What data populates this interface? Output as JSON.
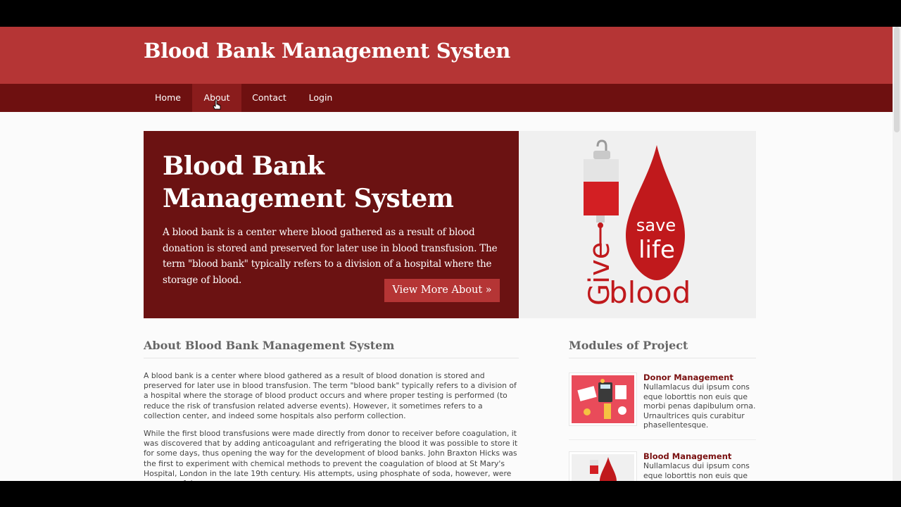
{
  "header": {
    "title": "Blood Bank Management Systen"
  },
  "nav": {
    "items": [
      {
        "label": "Home"
      },
      {
        "label": "About"
      },
      {
        "label": "Contact"
      },
      {
        "label": "Login"
      }
    ],
    "active": "About"
  },
  "hero": {
    "title": "Blood Bank Management System",
    "text": "A blood bank is a center where blood gathered as a result of blood donation is stored and preserved for later use in blood transfusion. The term \"blood bank\" typically refers to a division of a hospital where the storage of blood.",
    "button_label": "View More About »",
    "image": {
      "icon": "give-blood-save-life-logo",
      "text_save": "save",
      "text_life": "life",
      "text_give": "Give",
      "text_blood": "blood"
    }
  },
  "about": {
    "heading": "About Blood Bank Management System",
    "paragraphs": [
      "A blood bank is a center where blood gathered as a result of blood donation is stored and preserved for later use in blood transfusion. The term \"blood bank\" typically refers to a division of a hospital where the storage of blood product occurs and where proper testing is performed (to reduce the risk of transfusion related adverse events). However, it sometimes refers to a collection center, and indeed some hospitals also perform collection.",
      "While the first blood transfusions were made directly from donor to receiver before coagulation, it was discovered that by adding anticoagulant and refrigerating the blood it was possible to store it for some days, thus opening the way for the development of blood banks. John Braxton Hicks was the first to experiment with chemical methods to prevent the coagulation of blood at St Mary's Hospital, London in the late 19th century. His attempts, using phosphate of soda, however, were unsuccessful."
    ]
  },
  "modules": {
    "heading": "Modules of Project",
    "items": [
      {
        "title": "Donor Management",
        "desc": "Nullamlacus dui ipsum cons eque loborttis non euis que morbi penas dapibulum orna. Urnaultrices quis curabitur phasellentesque.",
        "icon": "donor-illustration"
      },
      {
        "title": "Blood Management",
        "desc": "Nullamlacus dui ipsum cons eque loborttis non euis que morbi penas dapibulum orna.",
        "icon": "blood-logo-thumbnail"
      }
    ]
  },
  "colors": {
    "header_bg": "#b53535",
    "nav_bg": "#6e1010",
    "hero_bg": "#6b1212",
    "accent": "#c0191c",
    "module_title": "#7a1010"
  }
}
